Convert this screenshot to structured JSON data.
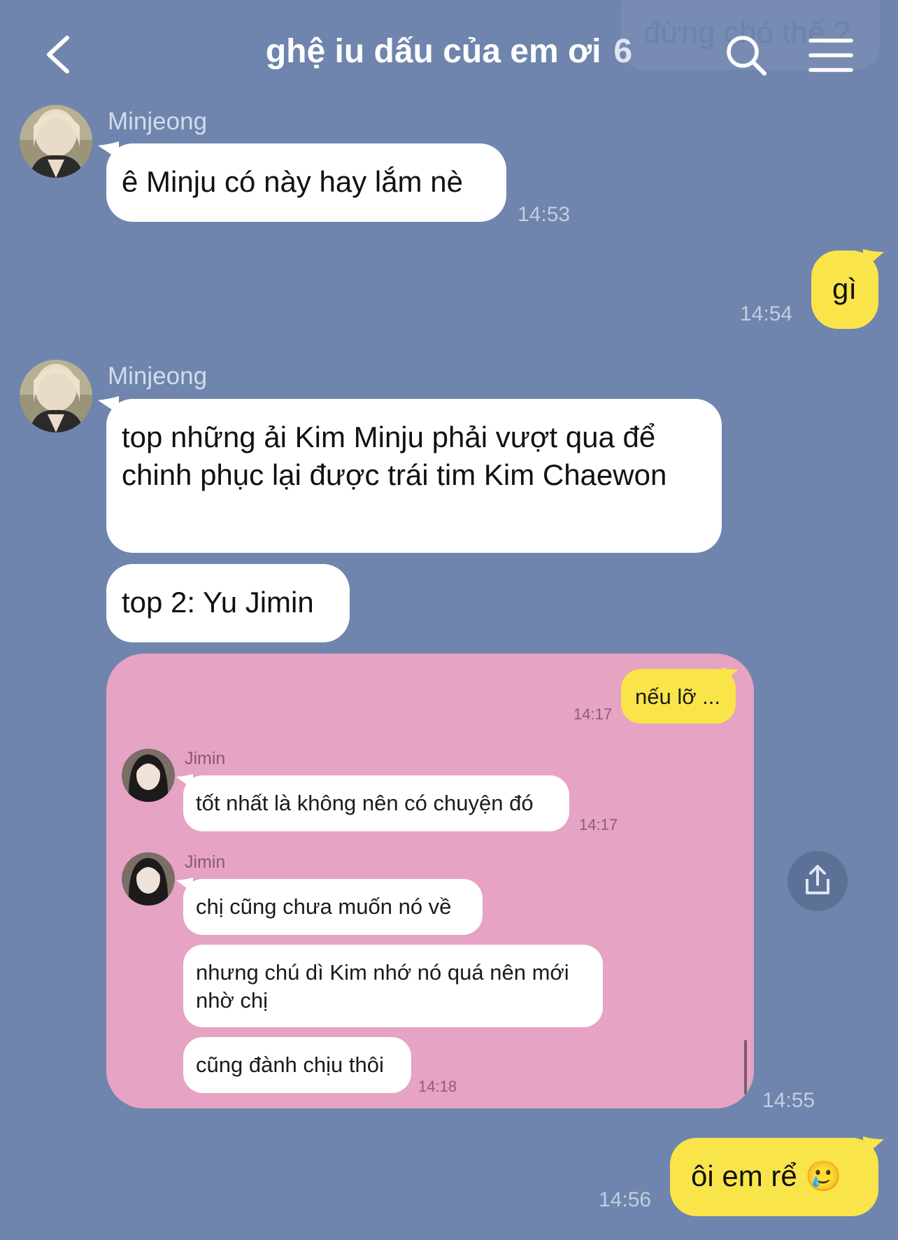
{
  "header": {
    "back_icon": "chevron-left-icon",
    "title": "ghệ iu dấu của em ơi",
    "member_count": "6",
    "search_icon": "search-icon",
    "menu_icon": "hamburger-menu-icon",
    "ghost_preview": "đừng chó thế ?"
  },
  "messages": [
    {
      "sender": "Minjeong",
      "text": "ê Minju có này hay lắm nè",
      "time": "14:53"
    },
    {
      "text": "gì",
      "time": "14:54"
    },
    {
      "sender": "Minjeong",
      "text": "top những ải Kim Minju phải vượt qua để chinh phục lại được trái tim Kim Chaewon"
    },
    {
      "text": "top 2: Yu Jimin"
    },
    {
      "time": "14:55"
    },
    {
      "text": "ôi em rể 🥲",
      "time": "14:56"
    }
  ],
  "shared_image": {
    "messages": [
      {
        "text": "nếu lỡ ...",
        "time": "14:17"
      },
      {
        "sender": "Jimin",
        "text": "tốt nhất là không nên có chuyện đó",
        "time": "14:17"
      },
      {
        "sender": "Jimin",
        "text": "chị cũng chưa muốn nó về"
      },
      {
        "text": "nhưng chú dì Kim nhớ nó quá nên mới nhờ chị"
      },
      {
        "text": "cũng đành chịu thôi",
        "time": "14:18"
      }
    ]
  },
  "share_icon": "share-upload-icon",
  "colors": {
    "background": "#6f85ad",
    "bubble_self": "#f9e54a",
    "bubble_other": "#ffffff",
    "shared_image_bg": "#e6a3c3"
  }
}
